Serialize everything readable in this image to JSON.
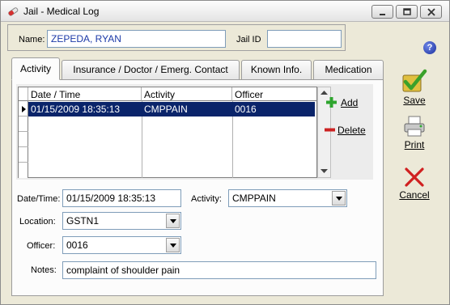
{
  "window": {
    "title": "Jail - Medical Log"
  },
  "header": {
    "name_label": "Name:",
    "name_value": "ZEPEDA, RYAN",
    "jail_id_label": "Jail ID",
    "jail_id_value": ""
  },
  "tabs": [
    {
      "label": "Activity",
      "active": true
    },
    {
      "label": "Insurance / Doctor / Emerg. Contact",
      "active": false
    },
    {
      "label": "Known Info.",
      "active": false
    },
    {
      "label": "Medication",
      "active": false
    }
  ],
  "grid": {
    "columns": [
      "Date / Time",
      "Activity",
      "Officer"
    ],
    "rows": [
      {
        "datetime": "01/15/2009 18:35:13",
        "activity": "CMPPAIN",
        "officer": "0016",
        "selected": true
      }
    ]
  },
  "grid_actions": {
    "add_label": "Add",
    "delete_label": "Delete"
  },
  "form": {
    "datetime_label": "Date/Time:",
    "datetime_value": "01/15/2009 18:35:13",
    "activity_label": "Activity:",
    "activity_value": "CMPPAIN",
    "location_label": "Location:",
    "location_value": "GSTN1",
    "officer_label": "Officer:",
    "officer_value": "0016",
    "notes_label": "Notes:",
    "notes_value": "complaint of shoulder pain"
  },
  "actions": {
    "save_label": "Save",
    "print_label": "Print",
    "cancel_label": "Cancel"
  },
  "colors": {
    "selection": "#0a246a",
    "name_text": "#1c3aa8",
    "save_check": "#3aa12a",
    "cancel_x": "#d02020",
    "add_plus": "#2ea52e",
    "delete_minus": "#cc2222"
  }
}
